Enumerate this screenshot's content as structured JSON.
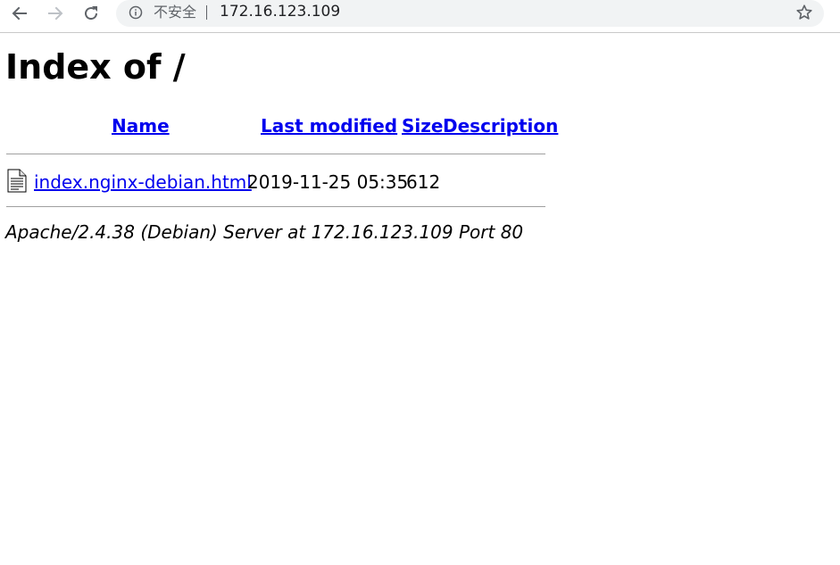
{
  "browser": {
    "security_label": "不安全",
    "url": "172.16.123.109"
  },
  "page": {
    "title": "Index of /",
    "columns": {
      "name": "Name",
      "last_modified": "Last modified",
      "size": "Size",
      "description": "Description"
    },
    "rows": [
      {
        "name": "index.nginx-debian.html",
        "last_modified": "2019-11-25 05:35",
        "size": "612",
        "description": ""
      }
    ],
    "server_signature": "Apache/2.4.38 (Debian) Server at 172.16.123.109 Port 80"
  }
}
